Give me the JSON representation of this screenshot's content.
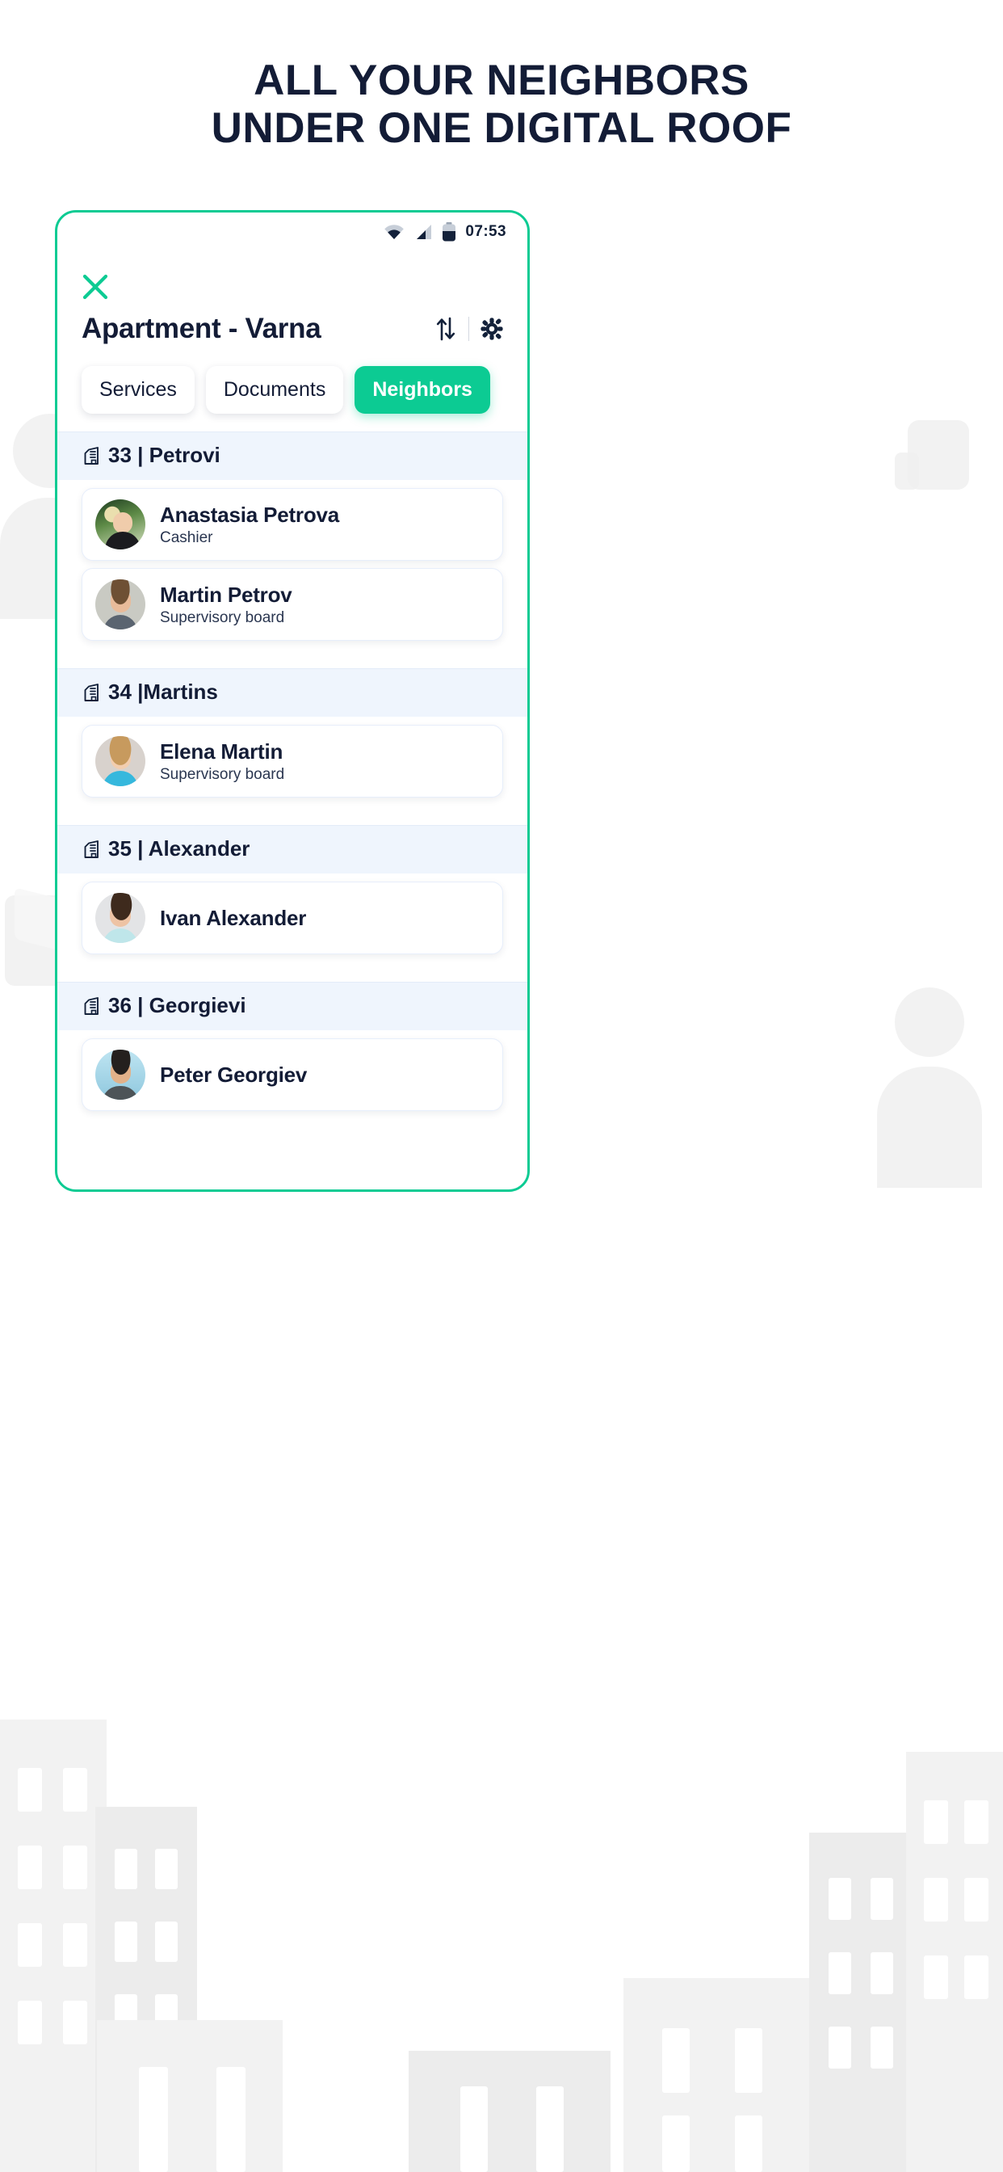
{
  "headline": {
    "line1": "ALL YOUR NEIGHBORS",
    "line2": "UNDER ONE DIGITAL ROOF",
    "color": "#131c36"
  },
  "theme": {
    "accent": "#0ccb93",
    "dark": "#131c36",
    "group_bg": "#eff5fd"
  },
  "phone": {
    "status_bar": {
      "wifi_icon": "wifi-icon",
      "signal_icon": "signal-icon",
      "battery_icon": "battery-icon",
      "time": "07:53"
    },
    "header": {
      "close_icon": "close-icon",
      "title": "Apartment - Varna",
      "sort_icon": "sort-arrows-icon",
      "settings_icon": "gear-icon"
    },
    "tabs": [
      {
        "label": "Services",
        "active": false
      },
      {
        "label": "Documents",
        "active": false
      },
      {
        "label": "Neighbors",
        "active": true
      }
    ],
    "groups": [
      {
        "icon": "building-icon",
        "title": "33 | Petrovi",
        "residents": [
          {
            "name": "Anastasia Petrova",
            "role": "Cashier",
            "avatar": "avatar-anastasia"
          },
          {
            "name": "Martin Petrov",
            "role": "Supervisory board",
            "avatar": "avatar-martin"
          }
        ]
      },
      {
        "icon": "building-icon",
        "title": "34 |Martins",
        "residents": [
          {
            "name": "Elena Martin",
            "role": "Supervisory board",
            "avatar": "avatar-elena"
          }
        ]
      },
      {
        "icon": "building-icon",
        "title": "35 | Alexander",
        "residents": [
          {
            "name": "Ivan Alexander",
            "role": "",
            "avatar": "avatar-ivan"
          }
        ]
      },
      {
        "icon": "building-icon",
        "title": "36 | Georgievi",
        "residents": [
          {
            "name": "Peter Georgiev",
            "role": "",
            "avatar": "avatar-peter"
          }
        ]
      }
    ]
  }
}
